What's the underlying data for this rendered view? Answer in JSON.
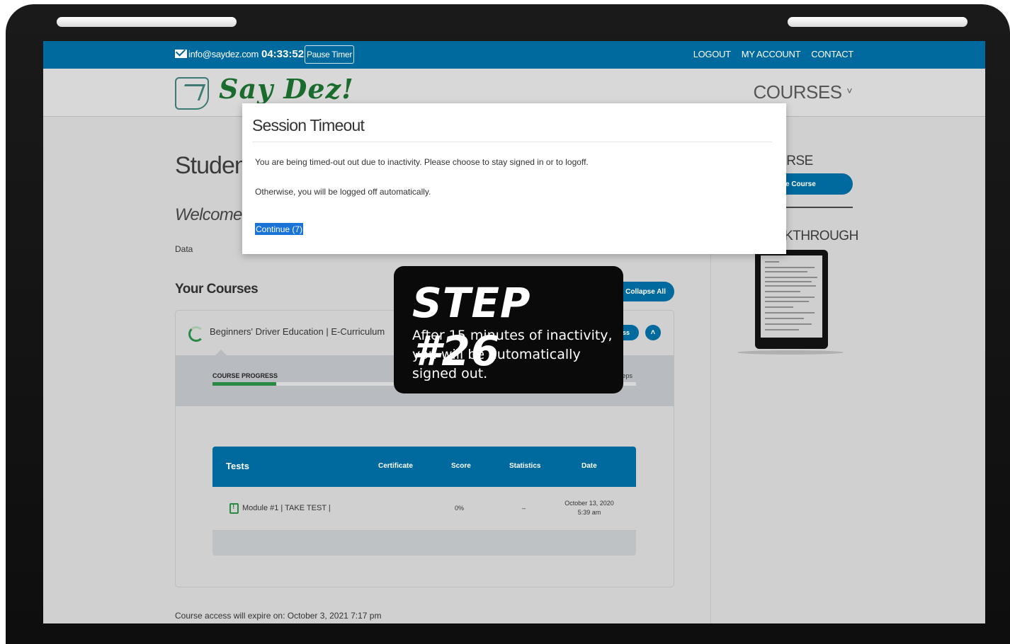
{
  "topbar": {
    "email": "info@saydez.com",
    "timer": "04:33:52",
    "pause_label": "Pause Timer",
    "nav": [
      "LOGOUT",
      "MY ACCOUNT",
      "CONTACT"
    ]
  },
  "header": {
    "logo_text": "Say Dez!",
    "courses_label": "COURSES",
    "courses_chevron": "˅"
  },
  "main": {
    "title": "Student",
    "welcome": "Welcome ba",
    "data_label": "Data",
    "your_courses": "Your Courses",
    "collapse_all": "Collapse All",
    "course": {
      "name": "Beginners' Driver Education | E-Curriculum",
      "status_fragment": "ss",
      "progress_label": "COURSE PROGRESS",
      "progress_percent": 15,
      "steps_fragment": "teps"
    },
    "tests": {
      "headers": [
        "Tests",
        "Certificate",
        "Score",
        "Statistics",
        "Date"
      ],
      "rows": [
        {
          "name": "Module #1 | TAKE TEST |",
          "score": "0%",
          "statistics": "–",
          "date_line1": "October 13, 2020",
          "date_line2": "5:39 am"
        }
      ]
    },
    "expire": "Course access will expire on: October 3, 2021 7:17 pm"
  },
  "sidebar": {
    "heading1": "URSE",
    "button": "e Course",
    "heading2": "LKTHROUGH"
  },
  "modal": {
    "title": "Session Timeout",
    "line1": "You are being timed-out out due to inactivity. Please choose to stay signed in or to logoff.",
    "line2": "Otherwise, you will be logged off automatically.",
    "continue_label": "Continue (7)"
  },
  "callout": {
    "title": "STEP #26",
    "text": "After 15 minutes of inactivity, you will be automatically signed out."
  }
}
